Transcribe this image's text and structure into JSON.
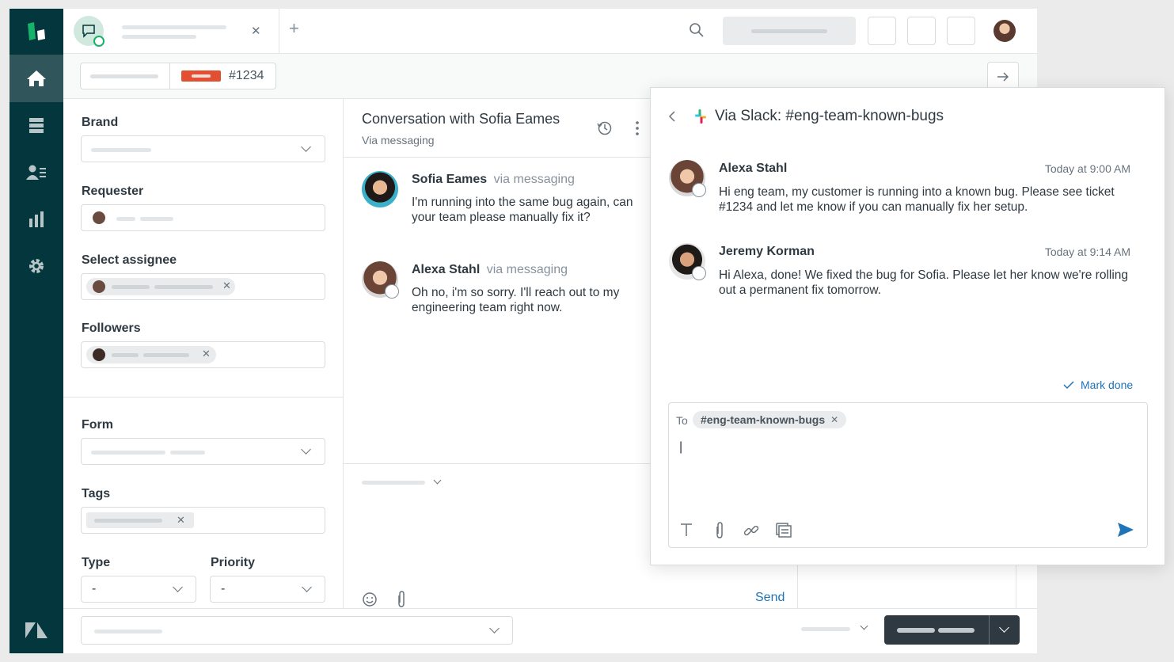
{
  "ticket": {
    "id": "#1234"
  },
  "properties": {
    "brand_label": "Brand",
    "requester_label": "Requester",
    "assignee_label": "Select assignee",
    "followers_label": "Followers",
    "form_label": "Form",
    "tags_label": "Tags",
    "type_label": "Type",
    "type_value": "-",
    "priority_label": "Priority",
    "priority_value": "-"
  },
  "conversation": {
    "title": "Conversation with Sofia Eames",
    "subtitle": "Via messaging",
    "messages": [
      {
        "author": "Sofia Eames",
        "via": "via messaging",
        "text": "I'm running into the same bug again, can your team please manually fix it?"
      },
      {
        "author": "Alexa Stahl",
        "via": "via messaging",
        "text": "Oh no, i'm so sorry. I'll reach out to my engineering team right now."
      }
    ],
    "send_label": "Send"
  },
  "slack_panel": {
    "title": "Via Slack: #eng-team-known-bugs",
    "messages": [
      {
        "author": "Alexa Stahl",
        "time": "Today at 9:00 AM",
        "text": "Hi eng team, my customer is running into a known bug. Please see ticket #1234 and let me know if you can manually fix her setup."
      },
      {
        "author": "Jeremy Korman",
        "time": "Today at 9:14 AM",
        "text": "Hi Alexa, done! We fixed the bug for Sofia. Please let her know we're rolling out a permanent fix tomorrow."
      }
    ],
    "mark_done_label": "Mark done",
    "to_label": "To",
    "to_chip": "#eng-team-known-bugs",
    "cursor": "|"
  },
  "colors": {
    "nav_bg": "#03363d",
    "nav_active": "#30565b",
    "brand_green": "#17b26a",
    "accent_blue": "#1f73b7",
    "ticket_red": "#e34f32"
  },
  "icons": [
    "zendesk-logo-icon",
    "home-icon",
    "views-icon",
    "customers-icon",
    "reporting-icon",
    "admin-gear-icon",
    "zendesk-z-icon",
    "chat-icon",
    "close-icon",
    "plus-icon",
    "search-icon",
    "arrow-right-icon",
    "history-icon",
    "more-vertical-icon",
    "chevron-left-icon",
    "slack-icon",
    "checkmark-icon",
    "text-format-icon",
    "attachment-icon",
    "link-icon",
    "template-icon",
    "send-arrow-icon",
    "emoji-icon",
    "chevron-down-icon"
  ]
}
